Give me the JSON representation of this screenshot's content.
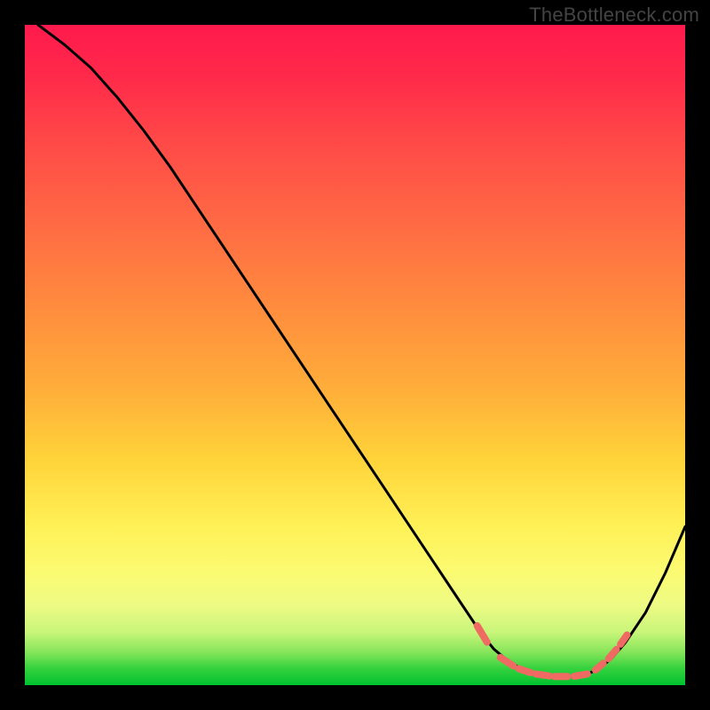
{
  "watermark": "TheBottleneck.com",
  "colors": {
    "page_bg": "#000000",
    "gradient_top": "#ff1a4d",
    "gradient_bottom": "#00c22e",
    "curve": "#000000",
    "marker": "#ef6a63"
  },
  "chart_data": {
    "type": "line",
    "title": "",
    "xlabel": "",
    "ylabel": "",
    "xlim": [
      0,
      100
    ],
    "ylim": [
      0,
      100
    ],
    "note": "No numeric axis labels are present; values are estimated from pixel positions on a 0–100 normalized scale.",
    "series": [
      {
        "name": "bottleneck-curve",
        "x": [
          2,
          6,
          10,
          14,
          18,
          22,
          26,
          30,
          34,
          38,
          42,
          46,
          50,
          54,
          58,
          62,
          66,
          69,
          71,
          73,
          75,
          77,
          79,
          81,
          83,
          85,
          87,
          89,
          91,
          94,
          97,
          100
        ],
        "y": [
          100,
          97,
          93.5,
          89,
          84,
          78.5,
          72.5,
          66.5,
          60.5,
          54.5,
          48.5,
          42.5,
          36.5,
          30.5,
          24.5,
          18.5,
          12.5,
          8,
          5.5,
          3.8,
          2.6,
          1.9,
          1.5,
          1.3,
          1.3,
          1.6,
          2.5,
          4.2,
          6.5,
          11,
          17,
          24
        ]
      }
    ],
    "markers": {
      "name": "highlighted-segments",
      "description": "Short dashed coral segments near the curve minimum.",
      "segments": [
        {
          "x0": 68.5,
          "y0": 9.0,
          "x1": 70.0,
          "y1": 6.5
        },
        {
          "x0": 72.0,
          "y0": 4.2,
          "x1": 74.0,
          "y1": 2.9
        },
        {
          "x0": 74.8,
          "y0": 2.5,
          "x1": 76.6,
          "y1": 1.9
        },
        {
          "x0": 77.4,
          "y0": 1.7,
          "x1": 79.4,
          "y1": 1.4
        },
        {
          "x0": 80.2,
          "y0": 1.3,
          "x1": 82.2,
          "y1": 1.3
        },
        {
          "x0": 83.2,
          "y0": 1.35,
          "x1": 85.2,
          "y1": 1.7
        },
        {
          "x0": 86.4,
          "y0": 2.3,
          "x1": 87.6,
          "y1": 3.3
        },
        {
          "x0": 88.4,
          "y0": 4.0,
          "x1": 89.6,
          "y1": 5.4
        },
        {
          "x0": 90.2,
          "y0": 6.2,
          "x1": 91.2,
          "y1": 7.6
        }
      ]
    }
  }
}
